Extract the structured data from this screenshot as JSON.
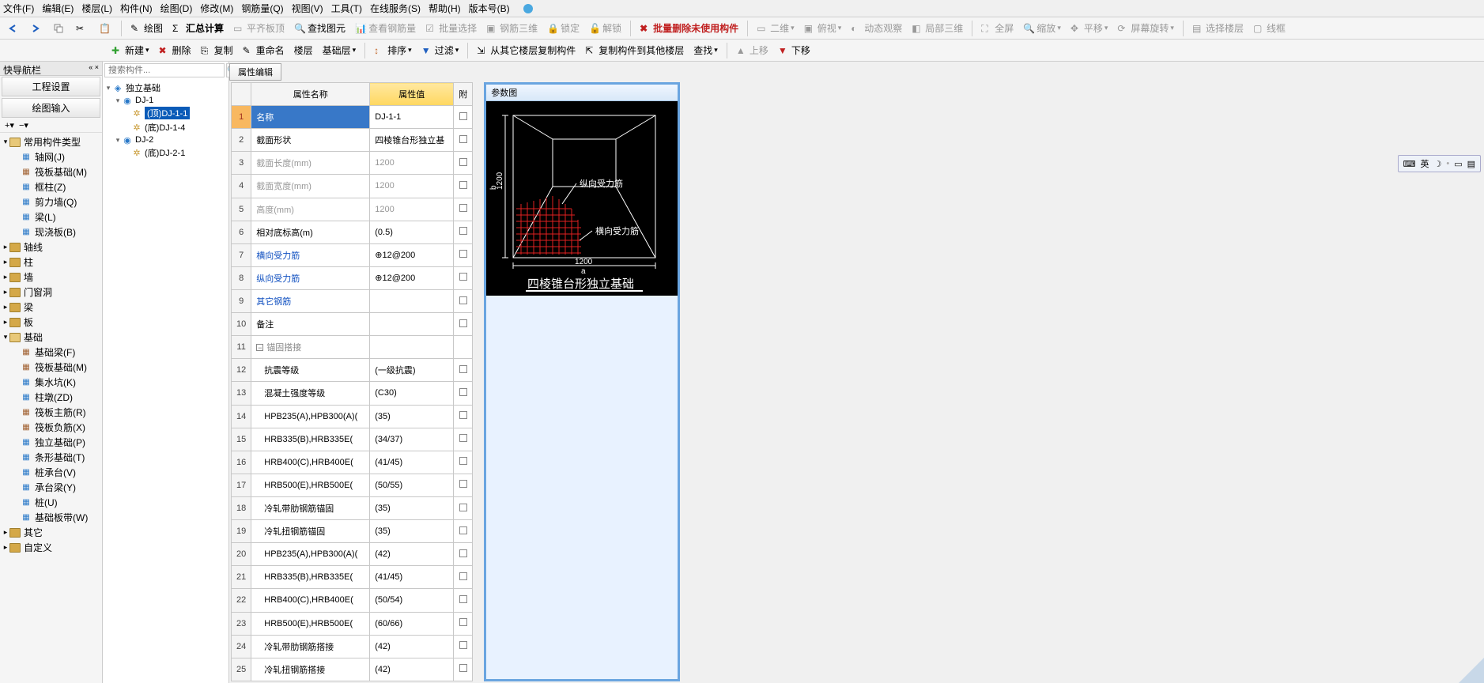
{
  "menus": [
    "文件(F)",
    "编辑(E)",
    "楼层(L)",
    "构件(N)",
    "绘图(D)",
    "修改(M)",
    "钢筋量(Q)",
    "视图(V)",
    "工具(T)",
    "在线服务(S)",
    "帮助(H)",
    "版本号(B)"
  ],
  "toolbar1": {
    "draw": "绘图",
    "sum": "汇总计算",
    "flatTop": "平齐板顶",
    "findEl": "查找图元",
    "viewRebar": "查看钢筋量",
    "batchSel": "批量选择",
    "rebar3d": "钢筋三维",
    "lock": "锁定",
    "unlock": "解锁",
    "batchDel": "批量删除未使用构件",
    "v2d": "二维",
    "bird": "俯视",
    "dyn": "动态观察",
    "local3d": "局部三维",
    "full": "全屏",
    "zoom": "缩放",
    "pan": "平移",
    "rot": "屏幕旋转",
    "selFloor": "选择楼层",
    "wire": "线框"
  },
  "toolbar2": {
    "new": "新建",
    "del": "删除",
    "copy": "复制",
    "rename": "重命名",
    "floor": "楼层",
    "fnd": "基础层",
    "sort": "排序",
    "filter": "过滤",
    "copyFrom": "从其它楼层复制构件",
    "copyTo": "复制构件到其他楼层",
    "find": "查找",
    "up": "上移",
    "down": "下移"
  },
  "leftNav": {
    "title": "快导航栏",
    "projSet": "工程设置",
    "drawInput": "绘图输入"
  },
  "tree1": [
    {
      "t": "常用构件类型",
      "open": true,
      "children": [
        {
          "t": "轴网(J)",
          "ic": "#2878c8"
        },
        {
          "t": "筏板基础(M)",
          "ic": "#a06030"
        },
        {
          "t": "框柱(Z)",
          "ic": "#2878c8"
        },
        {
          "t": "剪力墙(Q)",
          "ic": "#2878c8"
        },
        {
          "t": "梁(L)",
          "ic": "#2878c8"
        },
        {
          "t": "现浇板(B)",
          "ic": "#2878c8"
        }
      ]
    },
    {
      "t": "轴线"
    },
    {
      "t": "柱"
    },
    {
      "t": "墙"
    },
    {
      "t": "门窗洞"
    },
    {
      "t": "梁"
    },
    {
      "t": "板"
    },
    {
      "t": "基础",
      "open": true,
      "children": [
        {
          "t": "基础梁(F)",
          "ic": "#a06030"
        },
        {
          "t": "筏板基础(M)",
          "ic": "#a06030"
        },
        {
          "t": "集水坑(K)",
          "ic": "#2878c8"
        },
        {
          "t": "柱墩(ZD)",
          "ic": "#2878c8"
        },
        {
          "t": "筏板主筋(R)",
          "ic": "#a06030"
        },
        {
          "t": "筏板负筋(X)",
          "ic": "#a06030"
        },
        {
          "t": "独立基础(P)",
          "ic": "#2878c8"
        },
        {
          "t": "条形基础(T)",
          "ic": "#2878c8"
        },
        {
          "t": "桩承台(V)",
          "ic": "#2878c8"
        },
        {
          "t": "承台梁(Y)",
          "ic": "#2878c8"
        },
        {
          "t": "桩(U)",
          "ic": "#2878c8"
        },
        {
          "t": "基础板带(W)",
          "ic": "#2878c8"
        }
      ]
    },
    {
      "t": "其它"
    },
    {
      "t": "自定义"
    }
  ],
  "tree2": {
    "searchPlaceholder": "搜索构件...",
    "root": "独立基础",
    "items": [
      {
        "t": "DJ-1",
        "children": [
          {
            "t": "(顶)DJ-1-1",
            "sel": true
          },
          {
            "t": "(底)DJ-1-4"
          }
        ]
      },
      {
        "t": "DJ-2",
        "children": [
          {
            "t": "(底)DJ-2-1"
          }
        ]
      }
    ]
  },
  "propTab": "属性编辑",
  "propHeaders": {
    "name": "属性名称",
    "value": "属性值",
    "att": "附"
  },
  "propRows": [
    {
      "n": "名称",
      "v": "DJ-1-1",
      "sel": true
    },
    {
      "n": "截面形状",
      "v": "四棱锥台形独立基"
    },
    {
      "n": "截面长度(mm)",
      "v": "1200",
      "dim": true
    },
    {
      "n": "截面宽度(mm)",
      "v": "1200",
      "dim": true
    },
    {
      "n": "高度(mm)",
      "v": "1200",
      "dim": true
    },
    {
      "n": "相对底标高(m)",
      "v": "(0.5)"
    },
    {
      "n": "横向受力筋",
      "v": "⊕12@200",
      "link": true
    },
    {
      "n": "纵向受力筋",
      "v": "⊕12@200",
      "link": true
    },
    {
      "n": "其它钢筋",
      "v": "",
      "link": true
    },
    {
      "n": "备注",
      "v": ""
    },
    {
      "n": "锚固搭接",
      "grp": true
    },
    {
      "n": "抗震等级",
      "v": "(一级抗震)",
      "sub": true
    },
    {
      "n": "混凝土强度等级",
      "v": "(C30)",
      "sub": true
    },
    {
      "n": "HPB235(A),HPB300(A)(",
      "v": "(35)",
      "sub": true
    },
    {
      "n": "HRB335(B),HRB335E(",
      "v": "(34/37)",
      "sub": true
    },
    {
      "n": "HRB400(C),HRB400E(",
      "v": "(41/45)",
      "sub": true
    },
    {
      "n": "HRB500(E),HRB500E(",
      "v": "(50/55)",
      "sub": true
    },
    {
      "n": "冷轧带肋钢筋锚固",
      "v": "(35)",
      "sub": true
    },
    {
      "n": "冷轧扭钢筋锚固",
      "v": "(35)",
      "sub": true
    },
    {
      "n": "HPB235(A),HPB300(A)(",
      "v": "(42)",
      "sub": true
    },
    {
      "n": "HRB335(B),HRB335E(",
      "v": "(41/45)",
      "sub": true
    },
    {
      "n": "HRB400(C),HRB400E(",
      "v": "(50/54)",
      "sub": true
    },
    {
      "n": "HRB500(E),HRB500E(",
      "v": "(60/66)",
      "sub": true
    },
    {
      "n": "冷轧带肋钢筋搭接",
      "v": "(42)",
      "sub": true
    },
    {
      "n": "冷轧扭钢筋搭接",
      "v": "(42)",
      "sub": true
    }
  ],
  "diagram": {
    "title": "参数图",
    "label_v": "纵向受力筋",
    "label_h": "横向受力筋",
    "dim_b": "1200",
    "dim_a": "1200",
    "axis_b": "b",
    "axis_a": "a",
    "caption": "四棱锥台形独立基础"
  },
  "floatTb": {
    "ime": "英"
  }
}
